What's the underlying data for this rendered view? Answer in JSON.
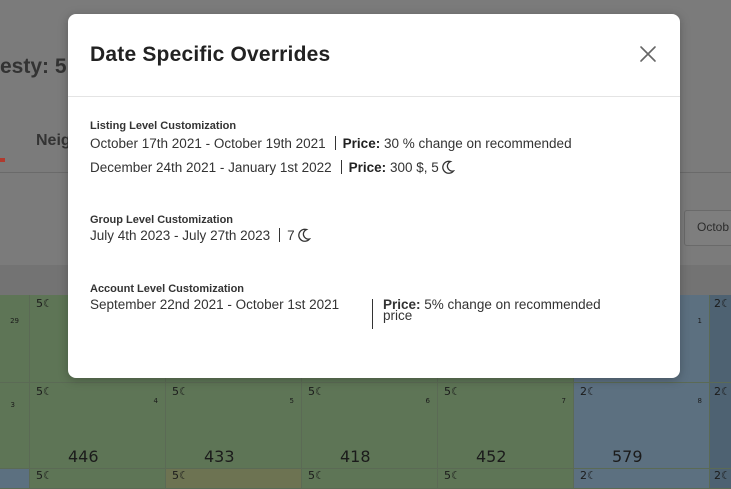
{
  "background": {
    "title_fragment": "esty: 5",
    "tab_fragment": "Neig",
    "date_fragment": "Octob",
    "calendar": {
      "row1": [
        {
          "nights": "5☾",
          "day": "",
          "price": ""
        },
        {
          "nights": "5☾",
          "day": "",
          "price": ""
        },
        {
          "nights": "5☾",
          "day": "",
          "price": ""
        },
        {
          "nights": "5☾",
          "day": "",
          "price": ""
        },
        {
          "nights": "2☾",
          "day": "1",
          "price": ""
        },
        {
          "nights": "2☾",
          "day": "",
          "price": ""
        }
      ],
      "row2": [
        {
          "nights": "5☾",
          "day": "4",
          "price": "446"
        },
        {
          "nights": "5☾",
          "day": "5",
          "price": "433"
        },
        {
          "nights": "5☾",
          "day": "6",
          "price": "418"
        },
        {
          "nights": "5☾",
          "day": "7",
          "price": "452"
        },
        {
          "nights": "2☾",
          "day": "8",
          "price": "579"
        },
        {
          "nights": "2☾",
          "day": "",
          "price": ""
        }
      ],
      "row3": [
        {
          "nights": "5☾"
        },
        {
          "nights": "5☾"
        },
        {
          "nights": "5☾"
        },
        {
          "nights": "5☾"
        },
        {
          "nights": "2☾"
        },
        {
          "nights": "2☾"
        }
      ],
      "left_day_row1": "29",
      "left_day_row2": "3"
    }
  },
  "modal": {
    "title": "Date Specific Overrides",
    "close_icon": "close-icon",
    "listing": {
      "title": "Listing Level Customization",
      "rows": [
        {
          "dates": "October 17th 2021 - October 19th 2021",
          "price_label": "Price:",
          "price_value": " 30 % change on recommended",
          "nights": ""
        },
        {
          "dates": "December 24th 2021 - January 1st 2022",
          "price_label": "Price:",
          "price_value": " 300 $, 5 ",
          "nights": "moon-icon"
        }
      ]
    },
    "group": {
      "title": "Group Level Customization",
      "rows": [
        {
          "dates": "July 4th 2023 - July 27th 2023",
          "nights_value": "7 "
        }
      ]
    },
    "account": {
      "title": "Account Level Customization",
      "dates": "September 22nd 2021 - October 1st 2021",
      "price_label": "Price:",
      "price_value": " 5% change on recommended price"
    }
  }
}
